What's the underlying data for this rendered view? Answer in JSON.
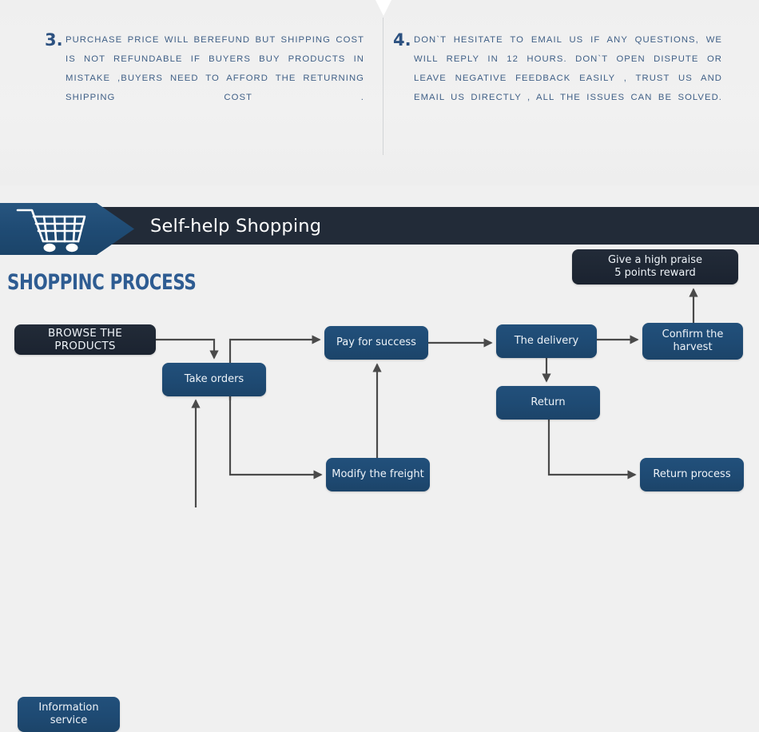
{
  "notes": [
    {
      "number": "3.",
      "text": "PURCHASE PRICE WILL BEREFUND BUT SHIPPING COST IS NOT REFUNDABLE IF BUYERS BUY PRODUCTS IN MISTAKE ,BUYERS NEED TO AFFORD THE RETURNING SHIPPING COST ."
    },
    {
      "number": "4.",
      "text": "DON`T HESITATE TO EMAIL US IF ANY QUESTIONS, WE WILL REPLY IN 12 HOURS. DON`T OPEN DISPUTE OR LEAVE NEGATIVE FEEDBACK EASILY , TRUST US AND EMAIL US DIRECTLY , ALL THE ISSUES CAN BE SOLVED."
    }
  ],
  "banner": {
    "title": "Self-help Shopping",
    "icon": "shopping-cart-icon",
    "dark_color": "#222b38",
    "accent_color": "#1f4b74"
  },
  "section": {
    "heading": "SHOPPINC PROCESS",
    "heading_color": "#2e5c92"
  },
  "flow": {
    "nodes": [
      {
        "id": "browse",
        "label": "BROWSE THE PRODUCTS",
        "style": "dark"
      },
      {
        "id": "take",
        "label": "Take orders",
        "style": "blue"
      },
      {
        "id": "info",
        "label": "Information\nservice",
        "style": "blue"
      },
      {
        "id": "pay",
        "label": "Pay for success",
        "style": "blue"
      },
      {
        "id": "modify",
        "label": "Modify the freight",
        "style": "blue"
      },
      {
        "id": "delivery",
        "label": "The delivery",
        "style": "blue"
      },
      {
        "id": "return",
        "label": "Return",
        "style": "blue"
      },
      {
        "id": "confirm",
        "label": "Confirm the\nharvest",
        "style": "blue"
      },
      {
        "id": "praise",
        "label": "Give a high praise\n5 points reward",
        "style": "dark"
      },
      {
        "id": "rproc",
        "label": "Return process",
        "style": "blue"
      }
    ],
    "edges": [
      {
        "from": "browse",
        "to": "take"
      },
      {
        "from": "info",
        "to": "take"
      },
      {
        "from": "take",
        "to": "pay"
      },
      {
        "from": "take",
        "to": "modify"
      },
      {
        "from": "modify",
        "to": "pay"
      },
      {
        "from": "pay",
        "to": "delivery"
      },
      {
        "from": "delivery",
        "to": "confirm"
      },
      {
        "from": "delivery",
        "to": "return"
      },
      {
        "from": "confirm",
        "to": "praise"
      },
      {
        "from": "return",
        "to": "rproc"
      }
    ],
    "node_color": "#1e4a73",
    "dark_node_color": "#222b38",
    "arrow_color": "#4a4a4a"
  }
}
